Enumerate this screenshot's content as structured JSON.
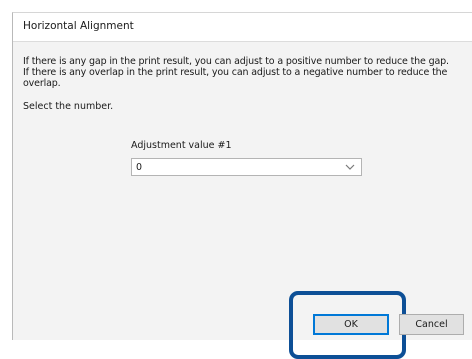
{
  "dialog": {
    "title": "Horizontal Alignment",
    "message_line1": "If there is any gap in the print result, you can adjust to a positive number to reduce the gap.",
    "message_line2": "If there is any overlap in the print result, you can adjust to a negative number to reduce the",
    "message_line3": "overlap.",
    "select_prompt": "Select the number.",
    "field_label": "Adjustment value #1",
    "field_value": "0",
    "ok_label": "OK",
    "cancel_label": "Cancel"
  },
  "icons": {
    "dropdown": "chevron-down-icon"
  },
  "colors": {
    "highlight_ring": "#0d4f96",
    "default_button_border": "#0078d7"
  }
}
